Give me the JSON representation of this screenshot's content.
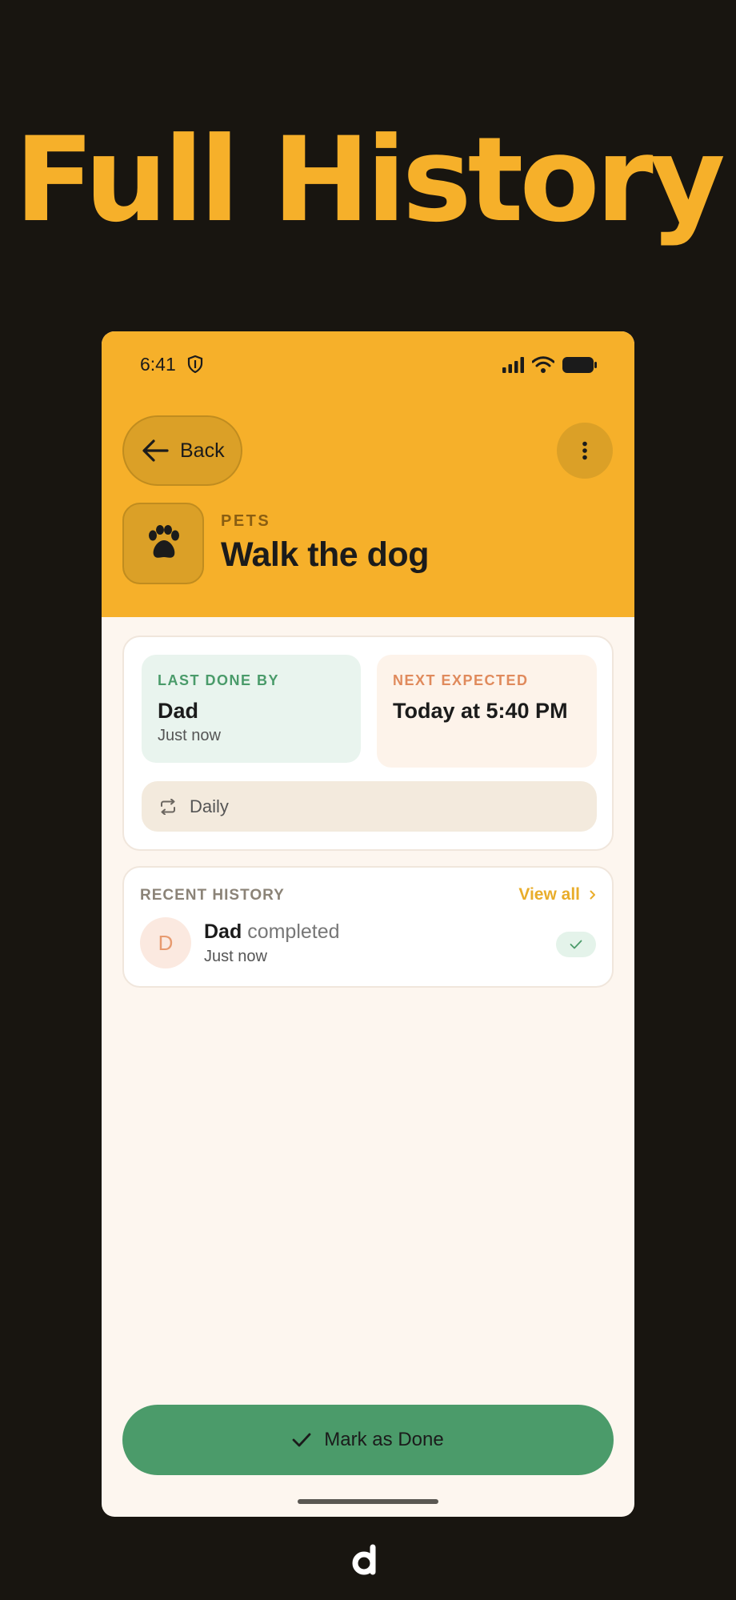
{
  "headline": "Full History",
  "status_bar": {
    "time": "6:41"
  },
  "header": {
    "back_label": "Back",
    "category": "PETS",
    "title": "Walk the dog"
  },
  "summary": {
    "last_done": {
      "label": "LAST DONE BY",
      "value": "Dad",
      "sub": "Just now"
    },
    "next_expected": {
      "label": "NEXT EXPECTED",
      "value": "Today at 5:40 PM"
    },
    "frequency": "Daily"
  },
  "history": {
    "title": "RECENT HISTORY",
    "view_all": "View all",
    "items": [
      {
        "avatar": "D",
        "user": "Dad",
        "action": "completed",
        "time": "Just now"
      }
    ]
  },
  "primary_action": "Mark as Done",
  "colors": {
    "accent": "#f6b02a",
    "success": "#4b9b6a",
    "background": "#181510"
  },
  "icons": [
    "shield-icon",
    "signal-icon",
    "wifi-icon",
    "battery-icon",
    "arrow-left-icon",
    "more-vertical-icon",
    "paw-icon",
    "repeat-icon",
    "chevron-right-icon",
    "check-icon",
    "brand-logo-icon"
  ]
}
